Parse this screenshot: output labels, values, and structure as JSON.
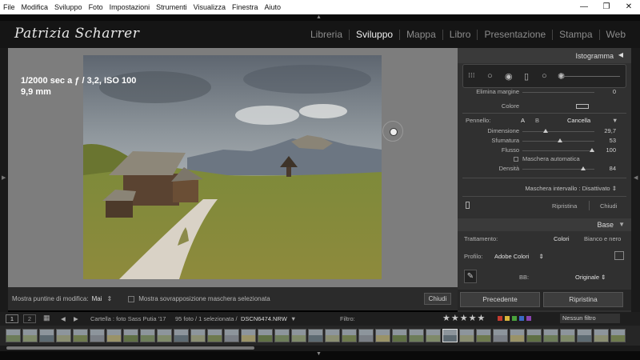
{
  "menubar": {
    "items": [
      "File",
      "Modifica",
      "Sviluppo",
      "Foto",
      "Impostazioni",
      "Strumenti",
      "Visualizza",
      "Finestra",
      "Aiuto"
    ],
    "minimize": "—",
    "maximize": "❐",
    "close": "✕"
  },
  "identity": {
    "logo_text": "Patrizia Scharrer"
  },
  "modules": {
    "items": [
      "Libreria",
      "Sviluppo",
      "Mappa",
      "Libro",
      "Presentazione",
      "Stampa",
      "Web"
    ],
    "active": "Sviluppo"
  },
  "photo": {
    "info_line1": "1/2000 sec a ƒ / 3,2, ISO 100",
    "info_line2": "9,9 mm"
  },
  "toolbar": {
    "show_pins_label": "Mostra puntine di modifica:",
    "show_pins_value": "Mai",
    "show_pins_arrow": "⇕",
    "mask_overlay_label": "Mostra sovrapposizione maschera selezionata",
    "close_label": "Chiudi"
  },
  "panel": {
    "histogram_label": "Istogramma",
    "histogram_arrow": "◀",
    "tool_icons": {
      "crop": "⁝⁝⁝",
      "spot": "○",
      "redeye": "◉",
      "gradient": "▯",
      "radial": "○",
      "brush": "✺"
    },
    "remove_margin_label": "Elimina margine",
    "remove_margin_value": "0",
    "color_label": "Colore",
    "brush_label": "Pennello:",
    "brush_a": "A",
    "brush_b": "B",
    "brush_erase": "Cancella",
    "brush_arrow": "▼",
    "sliders": [
      {
        "label": "Dimensione",
        "value": "29,7",
        "pos": 0.32
      },
      {
        "label": "Sfumatura",
        "value": "53",
        "pos": 0.52
      },
      {
        "label": "Flusso",
        "value": "100",
        "pos": 0.97
      }
    ],
    "auto_mask_label": "Maschera automatica",
    "density": {
      "label": "Densità",
      "value": "84",
      "pos": 0.84
    },
    "mask_interval_label": "Maschera intervallo : Disattivato",
    "mask_interval_arrow": "⇕",
    "reset_label": "Ripristina",
    "close_label": "Chiudi",
    "base_label": "Base",
    "base_arrow": "▼",
    "treatment_label": "Trattamento:",
    "treatment_colori": "Colori",
    "treatment_bn": "Bianco e nero",
    "profile_label": "Profilo:",
    "profile_value": "Adobe Colori",
    "profile_arrow": "⇕",
    "wb_label": "BB:",
    "wb_value": "Originale",
    "wb_arrow": "⇕",
    "eyedropper_icon": "✎",
    "prev_button": "Precedente",
    "reset_button": "Ripristina"
  },
  "filmbar": {
    "page1": "1",
    "page2": "2",
    "nav_back": "◀",
    "nav_forward": "▶",
    "grid_icon": "▦",
    "folder_text": "Cartella : foto Sass Putia '17",
    "count_text": "95 foto / 1 selezionata /",
    "file_name": "DSCN6474.NRW",
    "file_arrow": "▼",
    "filter_label": "Filtro:",
    "stars": "★★★★★",
    "no_filter": "Nessun filtro",
    "colors": [
      "#c33a2f",
      "#d8b63b",
      "#4aa33c",
      "#3a6ac4",
      "#8a44b0"
    ]
  },
  "accent": "#ffffff"
}
